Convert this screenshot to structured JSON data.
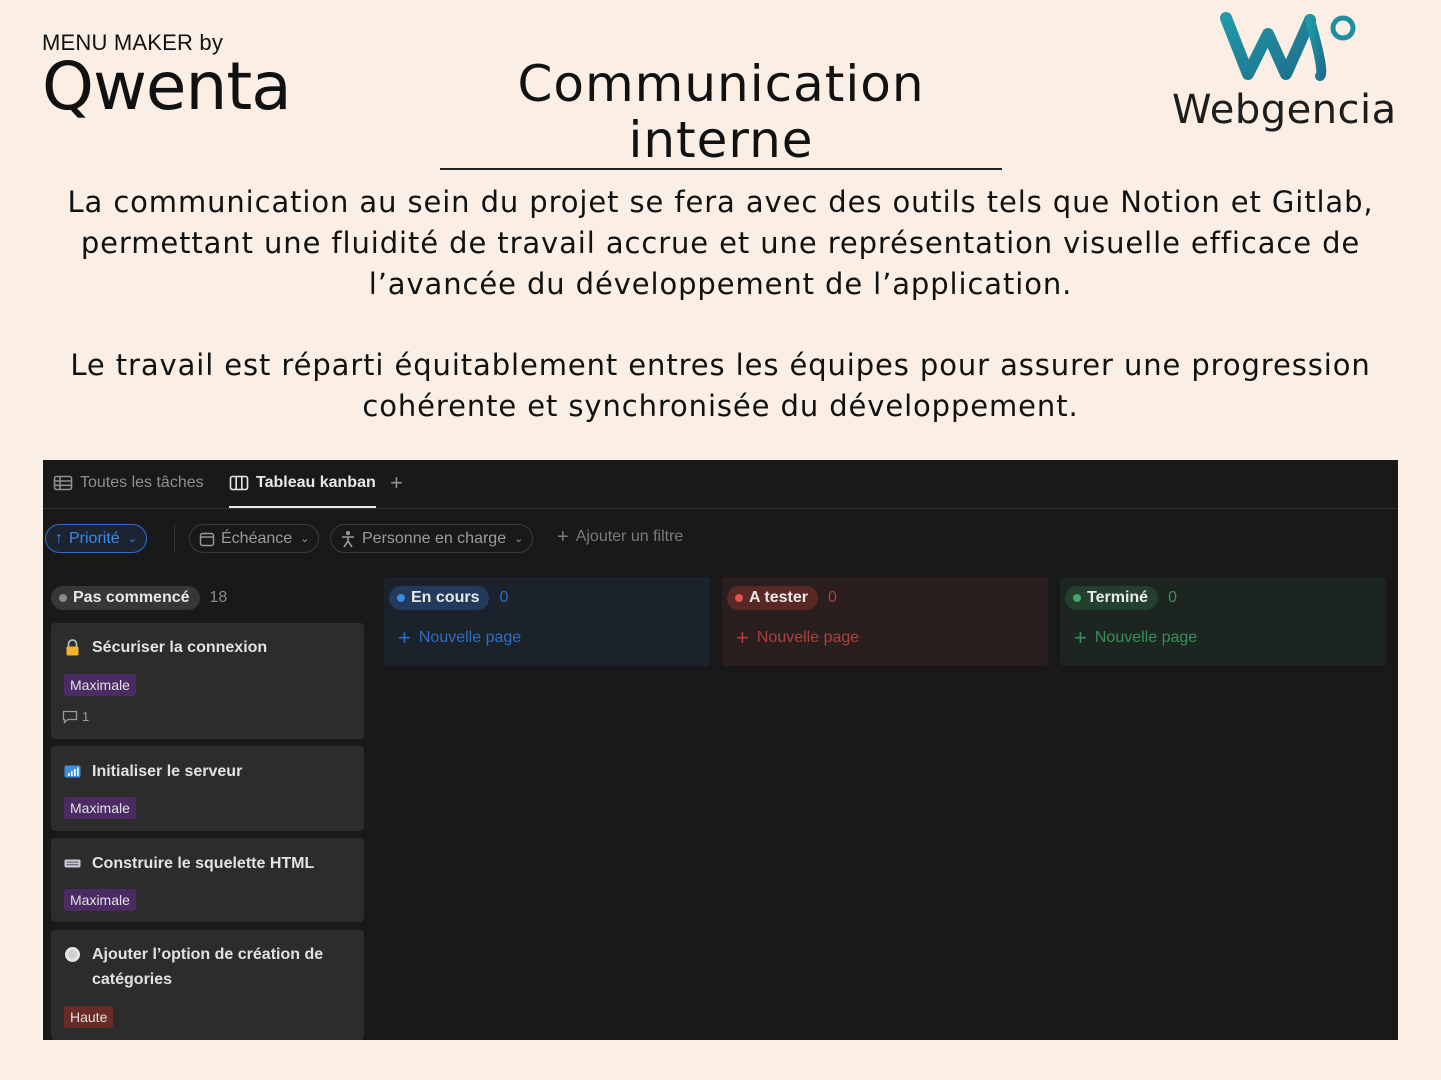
{
  "header": {
    "menu_maker_by": "MENU MAKER by",
    "qwenta_logo": "Qwenta",
    "title": "Communication interne",
    "webgencia_logo": "Webgencia"
  },
  "paragraphs": {
    "p1": "La communication au sein du projet se fera avec des outils tels que Notion et Gitlab, permettant une fluidité de travail accrue et une représentation visuelle efficace de l’avancée du développement de l’application.",
    "p2": "Le travail est réparti équitablement entres les équipes pour assurer une progression cohérente et synchronisée du développement."
  },
  "notion": {
    "tabs": [
      {
        "label": "Toutes les tâches",
        "icon": "table-icon",
        "active": false
      },
      {
        "label": "Tableau kanban",
        "icon": "board-icon",
        "active": true
      }
    ],
    "filters": {
      "priority": "Priorité",
      "due": "Échéance",
      "person": "Personne en charge",
      "add_filter": "Ajouter un filtre"
    },
    "columns": [
      {
        "status": "Pas commencé",
        "count": "18",
        "color": "#8a8a8a"
      },
      {
        "status": "En cours",
        "count": "0",
        "new_page": "Nouvelle page",
        "color": "#3b8ae6"
      },
      {
        "status": "A tester",
        "count": "0",
        "new_page": "Nouvelle page",
        "color": "#e2564e"
      },
      {
        "status": "Terminé",
        "count": "0",
        "new_page": "Nouvelle page",
        "color": "#3ea66a"
      }
    ],
    "cards": [
      {
        "title": "Sécuriser la connexion",
        "icon": "lock-icon",
        "tag": "Maximale",
        "comments": "1"
      },
      {
        "title": "Initialiser le serveur",
        "icon": "chart-icon",
        "tag": "Maximale"
      },
      {
        "title": "Construire le squelette HTML",
        "icon": "keyboard-icon",
        "tag": "Maximale"
      },
      {
        "title": "Ajouter l’option de création de catégories",
        "icon": "plate-icon",
        "tag": "Haute"
      }
    ]
  }
}
